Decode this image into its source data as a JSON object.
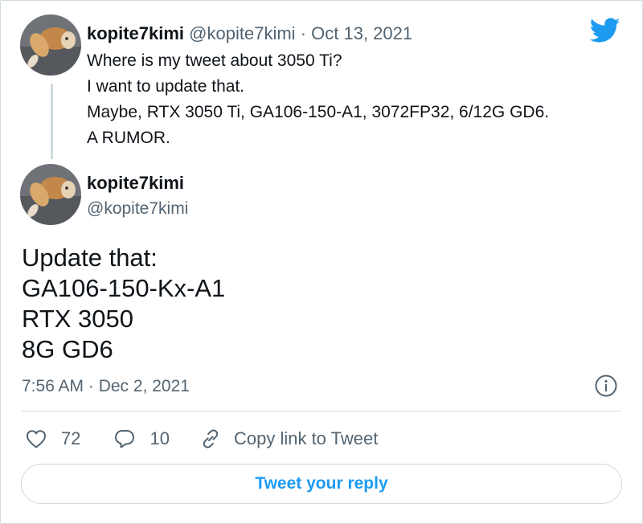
{
  "parent_tweet": {
    "display_name": "kopite7kimi",
    "handle": "@kopite7kimi",
    "separator": "·",
    "date": "Oct 13, 2021",
    "lines": [
      "Where is my tweet about 3050 Ti?",
      "I want to update that.",
      "Maybe, RTX 3050 Ti, GA106-150-A1, 3072FP32, 6/12G GD6.",
      "A RUMOR."
    ]
  },
  "main_tweet": {
    "display_name": "kopite7kimi",
    "handle": "@kopite7kimi",
    "lines": [
      "Update that:",
      "GA106-150-Kx-A1",
      "RTX 3050",
      "8G GD6"
    ],
    "timestamp": "7:56 AM · Dec 2, 2021"
  },
  "actions": {
    "like_count": "72",
    "reply_count": "10",
    "copy_link_label": "Copy link to Tweet"
  },
  "reply_button_label": "Tweet your reply",
  "icons": {
    "brand": "twitter-bird-icon",
    "info": "info-icon",
    "like": "heart-icon",
    "reply": "speech-bubble-icon",
    "copy": "link-icon"
  },
  "colors": {
    "brand_blue": "#1d9bf0",
    "text_primary": "#0f1419",
    "text_secondary": "#536471",
    "border": "#cfd9de"
  }
}
